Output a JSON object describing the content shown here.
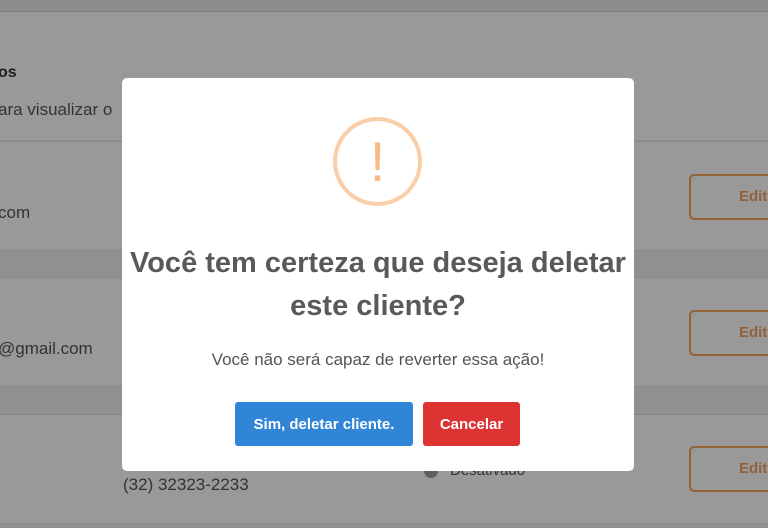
{
  "background": {
    "header": {
      "title": "os",
      "subtitle": "ara visualizar o"
    },
    "rows": [
      {
        "email": "com",
        "edit_label": "Edit"
      },
      {
        "email": "@gmail.com",
        "edit_label": "Edit"
      },
      {
        "phone": "(32) 32323-2233",
        "status": "Desativado",
        "edit_label": "Edit"
      }
    ]
  },
  "modal": {
    "icon": "!",
    "icon_name": "warning-icon",
    "title": "Você tem certeza que deseja deletar este cliente?",
    "text": "Você não será capaz de reverter essa ação!",
    "confirm_label": "Sim, deletar cliente.",
    "cancel_label": "Cancelar"
  },
  "colors": {
    "confirm": "#3085d6",
    "cancel": "#dd3333",
    "warning_icon": "#f8bb86",
    "edit_outline": "#f1a35a"
  }
}
